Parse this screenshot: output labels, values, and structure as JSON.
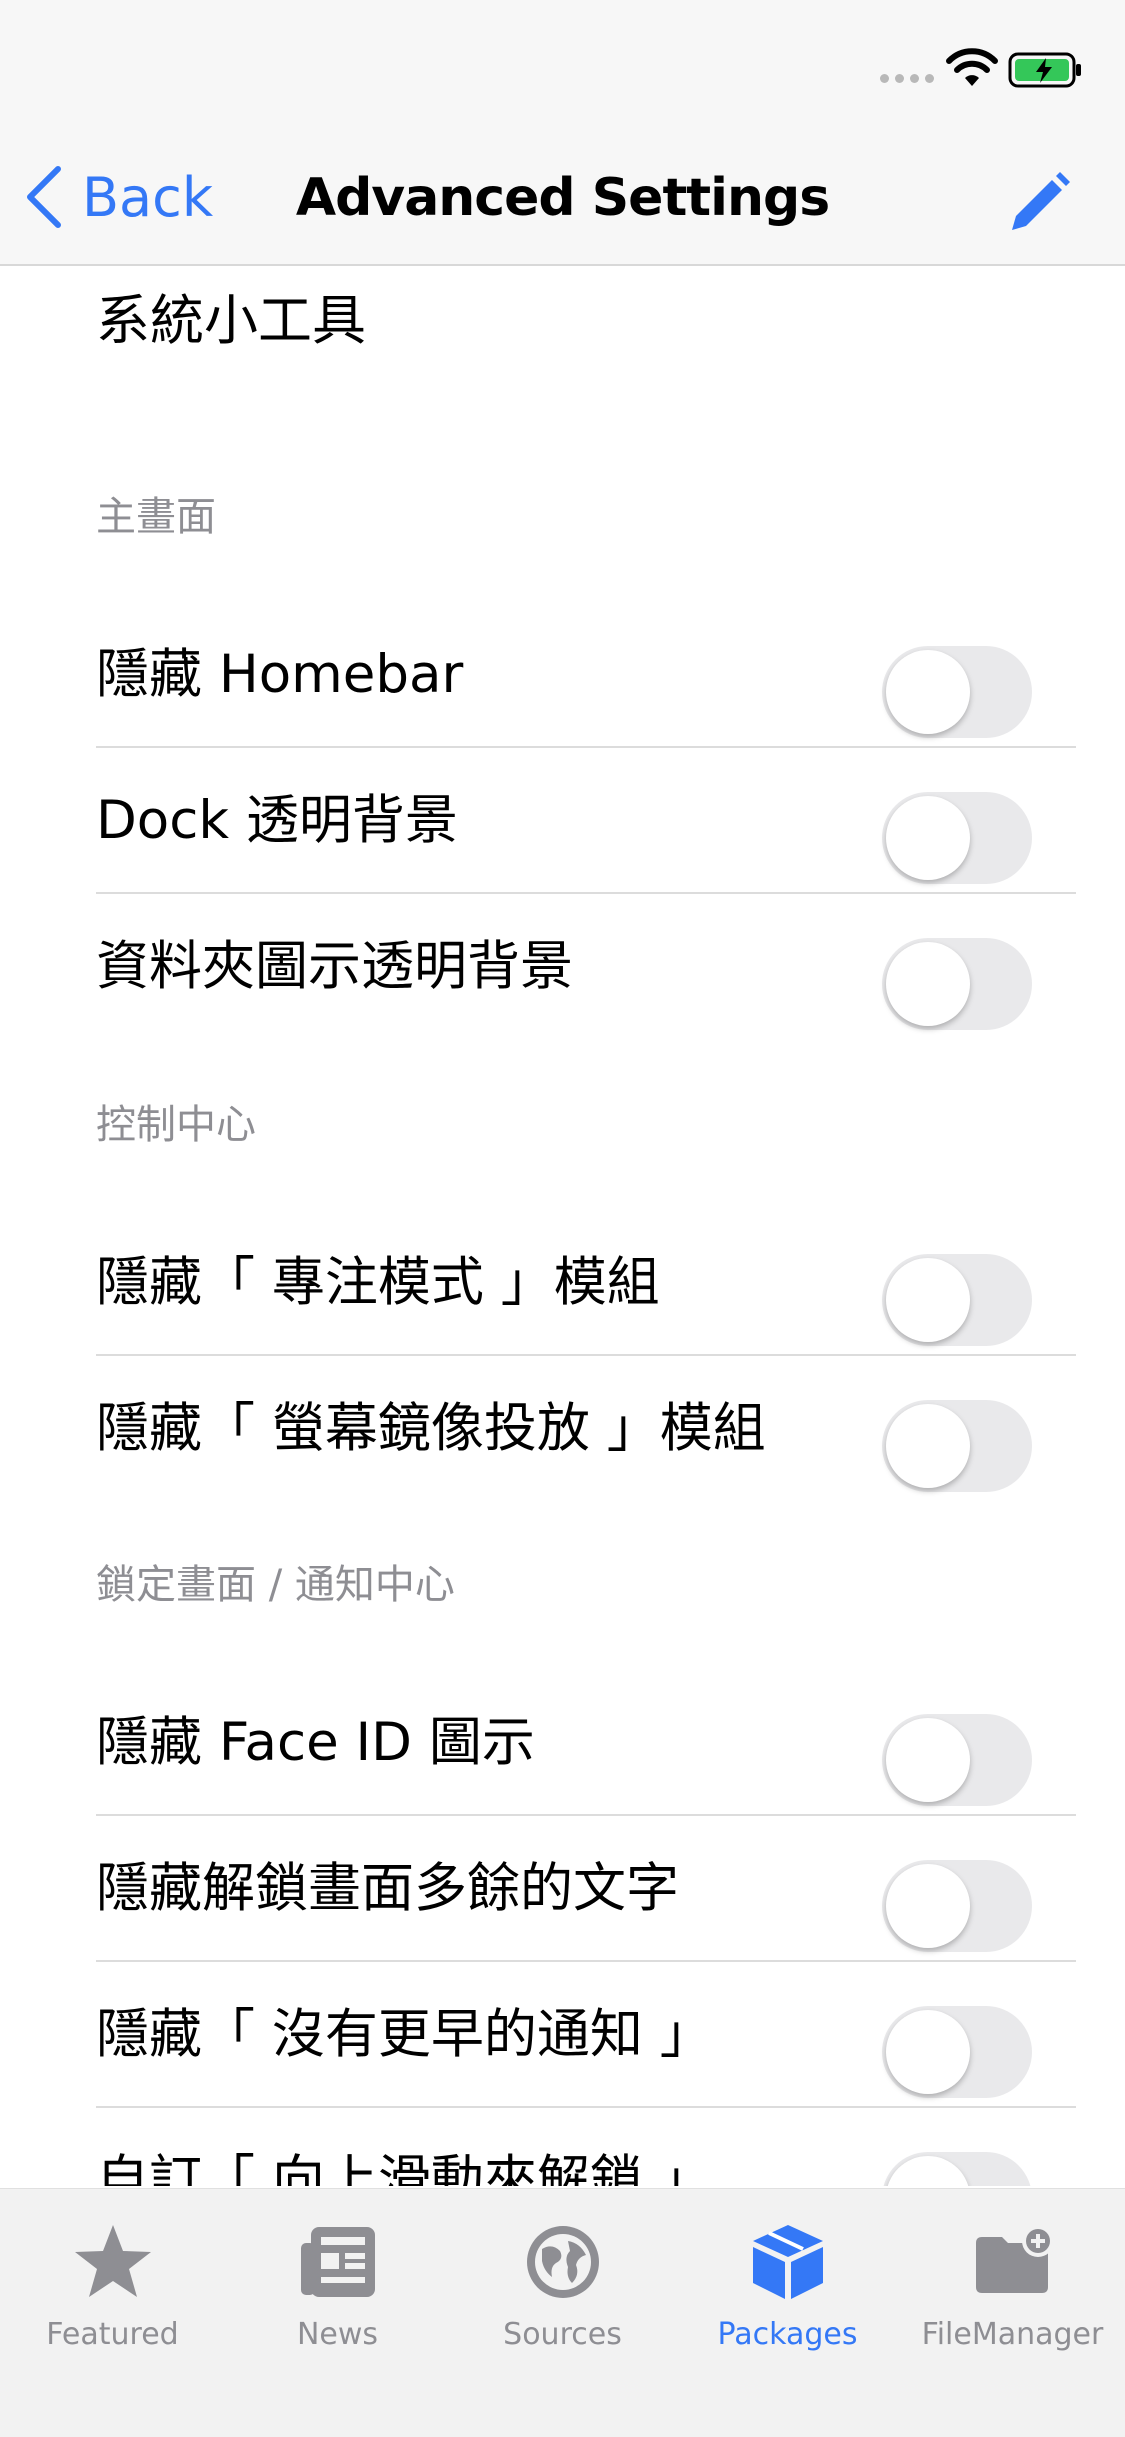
{
  "colors": {
    "accent": "#3478f6",
    "inactive_tab": "#8e8e93",
    "battery": "#34c759"
  },
  "status_bar": {
    "signal_icon": "signal-dots-icon",
    "wifi_icon": "wifi-icon",
    "battery_icon": "battery-charging-icon"
  },
  "navbar": {
    "back_label": "Back",
    "title": "Advanced Settings",
    "edit_icon": "pencil-icon"
  },
  "top_item": "系統小工具",
  "sections": [
    {
      "header": "主畫面",
      "rows": [
        {
          "label": "隱藏 Homebar",
          "on": false
        },
        {
          "label": "Dock 透明背景",
          "on": false
        },
        {
          "label": "資料夾圖示透明背景",
          "on": false
        }
      ]
    },
    {
      "header": "控制中心",
      "rows": [
        {
          "label": "隱藏「 專注模式 」模組",
          "on": false
        },
        {
          "label": "隱藏「 螢幕鏡像投放 」模組",
          "on": false
        }
      ]
    },
    {
      "header": "鎖定畫面 / 通知中心",
      "rows": [
        {
          "label": "隱藏 Face ID 圖示",
          "on": false
        },
        {
          "label": "隱藏解鎖畫面多餘的文字",
          "on": false
        },
        {
          "label": "隱藏「 沒有更早的通知 」",
          "on": false
        },
        {
          "label": "自訂「 向上滑動來解鎖 」",
          "on": false
        }
      ]
    }
  ],
  "tabs": [
    {
      "label": "Featured",
      "icon": "star-icon",
      "active": false
    },
    {
      "label": "News",
      "icon": "newspaper-icon",
      "active": false
    },
    {
      "label": "Sources",
      "icon": "globe-icon",
      "active": false
    },
    {
      "label": "Packages",
      "icon": "package-box-icon",
      "active": true
    },
    {
      "label": "FileManager",
      "icon": "folder-plus-icon",
      "active": false
    }
  ]
}
